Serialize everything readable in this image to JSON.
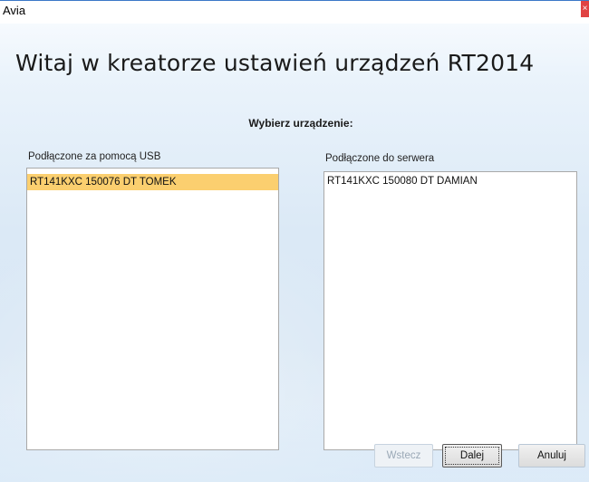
{
  "window": {
    "title": "Avia",
    "close_glyph": "×"
  },
  "wizard": {
    "title": "Witaj w kreatorze ustawień urządzeń RT2014",
    "choose_label": "Wybierz urządzenie:"
  },
  "usb_list": {
    "label": "Podłączone za pomocą USB",
    "items": [
      "RT141KXC 150076 DT TOMEK"
    ],
    "selected_index": 0
  },
  "server_list": {
    "label": "Podłączone do serwera",
    "items": [
      "RT141KXC 150080 DT DAMIAN"
    ]
  },
  "buttons": {
    "back": "Wstecz",
    "next": "Dalej",
    "cancel": "Anuluj"
  },
  "colors": {
    "selection": "#fbcf6f",
    "close_button": "#e04343"
  }
}
